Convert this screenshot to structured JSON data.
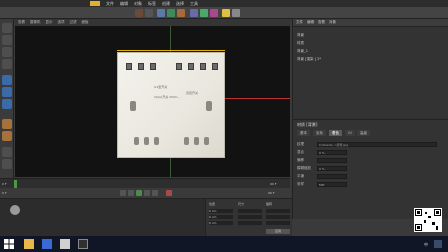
{
  "menubar": {
    "items": [
      "文件",
      "编辑",
      "对象",
      "标签",
      "创建",
      "选择",
      "工具",
      "网格",
      "捕捉",
      "动画",
      "模拟",
      "渲染",
      "雕刻",
      "运动跟踪",
      "运动图形",
      "角色",
      "流水线",
      "插件",
      "脚本",
      "窗口",
      "帮助"
    ]
  },
  "viewport": {
    "header_items": [
      "查看",
      "摄像机",
      "显示",
      "选项",
      "过滤",
      "面板"
    ],
    "object_label_line1": "G1型开关",
    "object_label_line2": "双控开关",
    "object_label_line3": "20(A)开关 250V~"
  },
  "object_manager": {
    "header_items": [
      "文件",
      "编辑",
      "查看",
      "对象",
      "标签",
      "书签"
    ],
    "rows": [
      "背景",
      "材质",
      "背景_1",
      "背景 [渲染 ] 2*"
    ]
  },
  "attribute_manager": {
    "title": "材质 [背景]",
    "tabs": [
      "基本",
      "坐标",
      "着色",
      "Gl",
      "高级"
    ],
    "active_tab": "着色",
    "fields": [
      {
        "label": "纹理",
        "value": "C:\\Users\\...\\背景.jpg"
      },
      {
        "label": "混合",
        "value": "0 %"
      },
      {
        "label": "偏移",
        "value": ""
      },
      {
        "label": "模糊缩放",
        "value": "0 %"
      },
      {
        "label": "平铺",
        "value": ""
      },
      {
        "label": "采样",
        "value": "MIP"
      }
    ]
  },
  "timeline": {
    "start": "0 F",
    "end": "90 F",
    "current": "0 F"
  },
  "coordinates": {
    "position_label": "位置",
    "size_label": "尺寸",
    "rotation_label": "旋转",
    "x": "0 cm",
    "y": "0 cm",
    "z": "0 cm",
    "apply_label": "应用"
  },
  "taskbar": {
    "time": "",
    "lang": "中"
  },
  "colors": {
    "accent": "#e0b000",
    "selection_axis": "#c03030"
  }
}
